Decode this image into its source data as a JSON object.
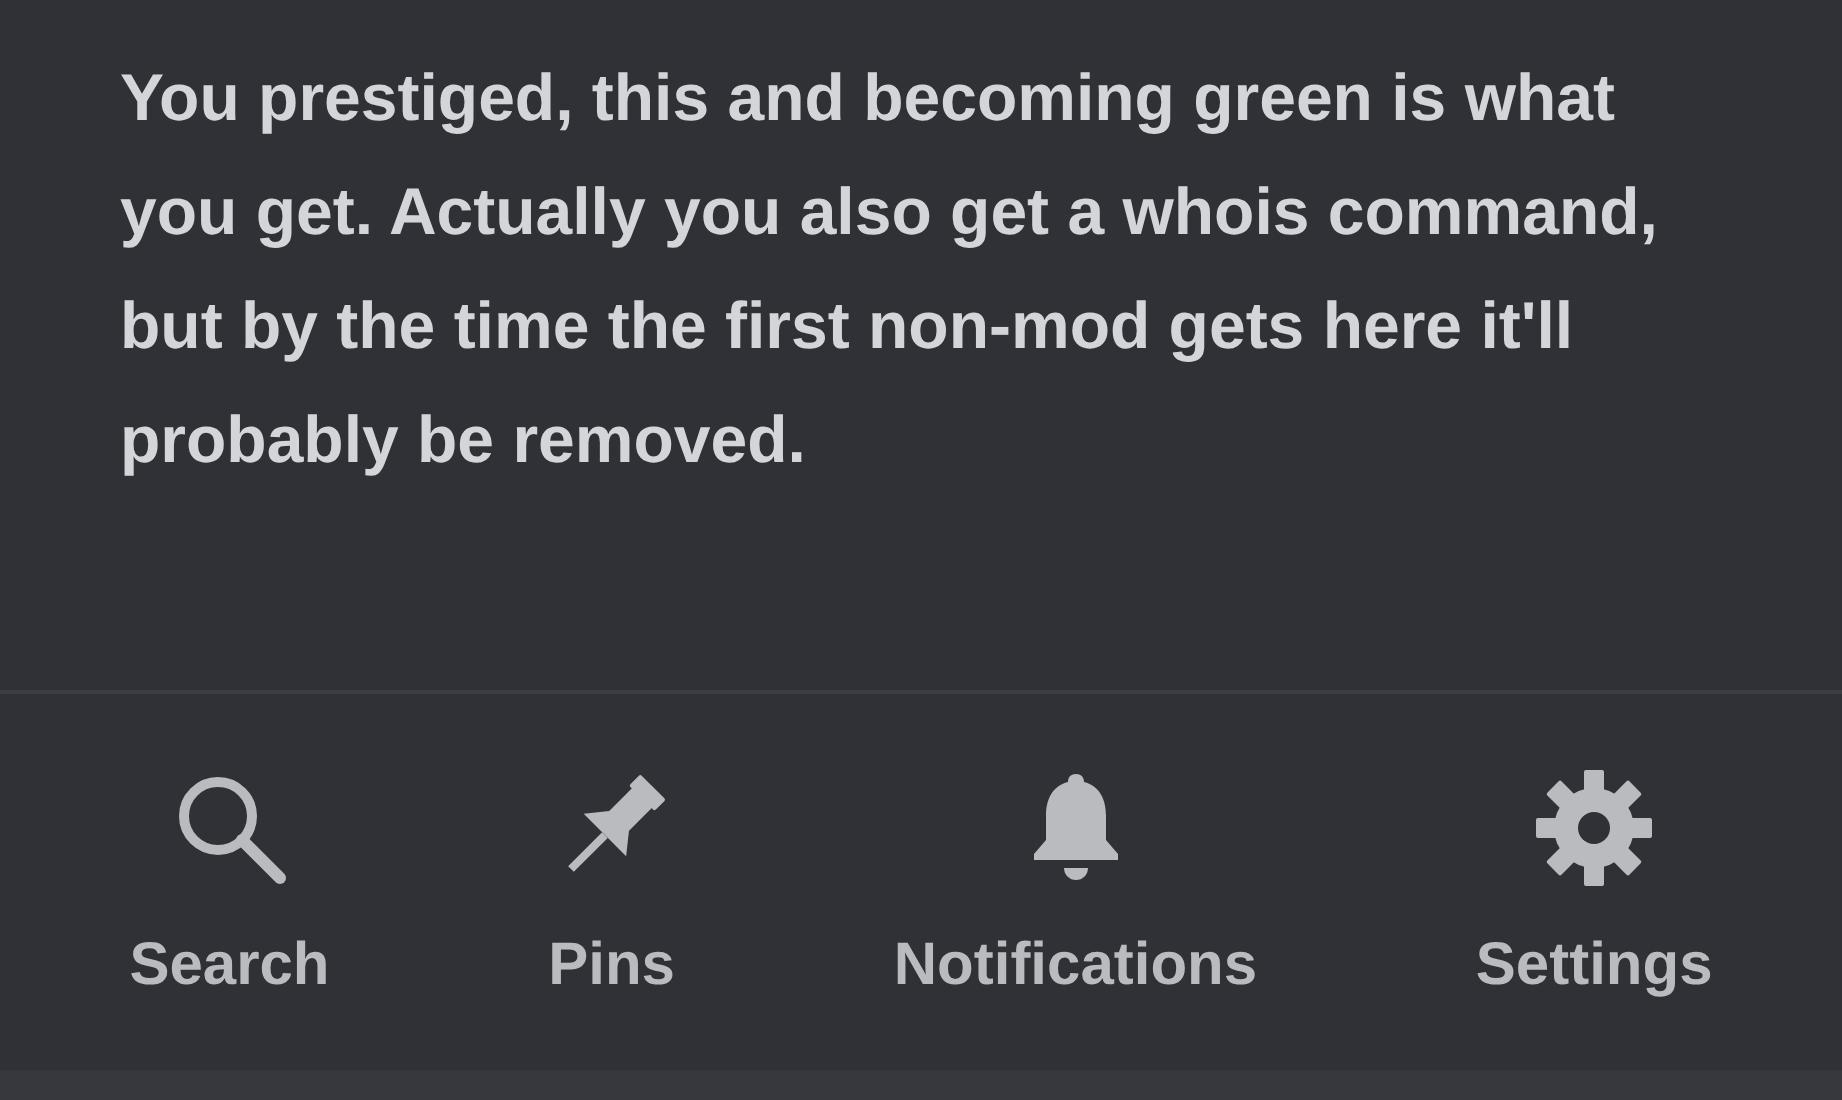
{
  "message": {
    "text": "You prestiged, this and becoming green is what you get. Actually you also get a whois command, but by the time the first non-mod gets here it'll probably be removed."
  },
  "actions": [
    {
      "kind": "search",
      "label": "Search"
    },
    {
      "kind": "pin",
      "label": "Pins"
    },
    {
      "kind": "bell",
      "label": "Notifications"
    },
    {
      "kind": "gear",
      "label": "Settings"
    }
  ]
}
